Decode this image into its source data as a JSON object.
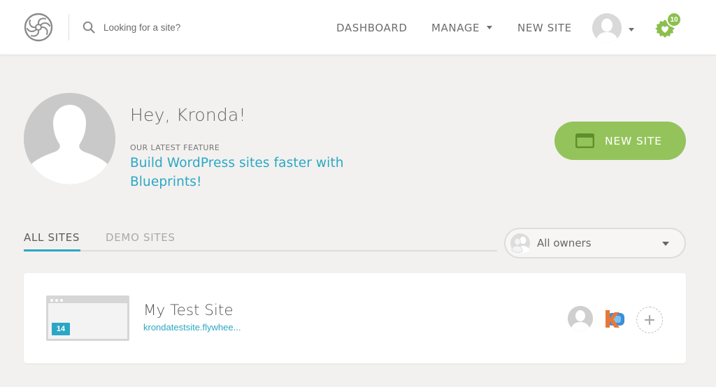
{
  "header": {
    "search": {
      "placeholder": "Looking for a site?"
    },
    "nav": {
      "dashboard": "DASHBOARD",
      "manage": "MANAGE",
      "new_site": "NEW SITE"
    },
    "notifications_count": "10"
  },
  "hero": {
    "greeting": "Hey, Kronda!",
    "feature_label": "OUR LATEST FEATURE",
    "feature_link": "Build WordPress sites faster with Blueprints!",
    "new_site_button": "NEW SITE"
  },
  "tabs": {
    "all_sites": "ALL SITES",
    "demo_sites": "DEMO SITES",
    "active": "all_sites"
  },
  "owners_filter": {
    "selected": "All owners"
  },
  "sites": [
    {
      "name": "My Test Site",
      "url": "krondatestsite.flywhee...",
      "php_version": "14"
    }
  ],
  "colors": {
    "accent_blue": "#2ba7c5",
    "accent_green": "#94c35c",
    "background": "#f2f1ef"
  }
}
